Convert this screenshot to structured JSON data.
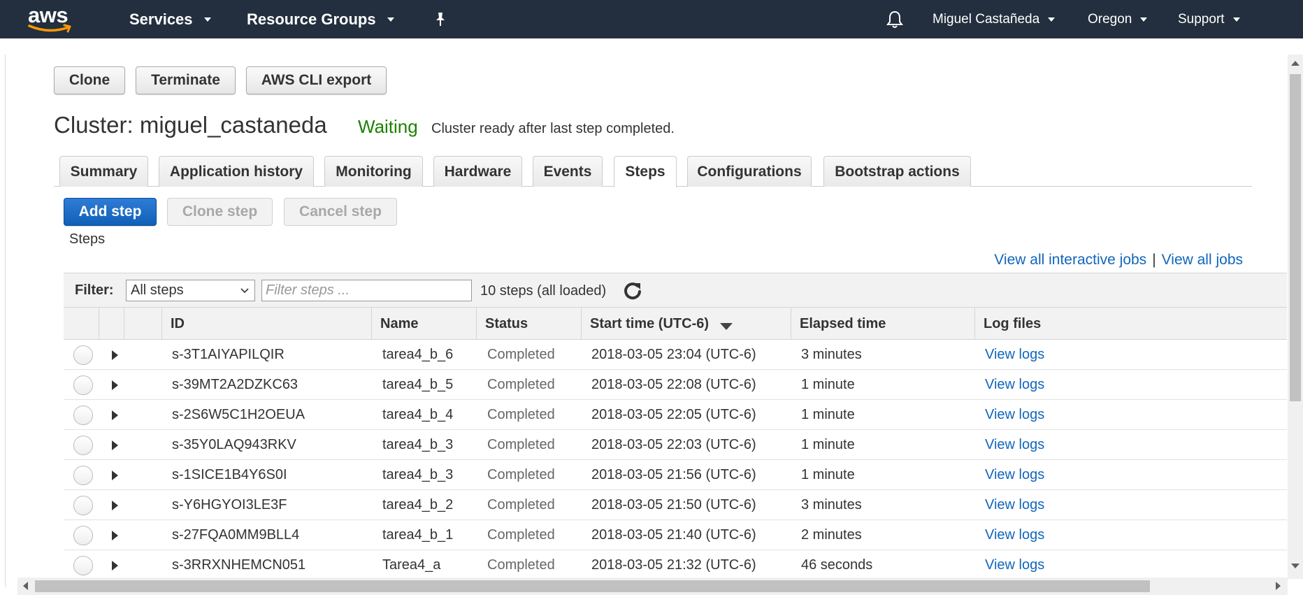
{
  "nav": {
    "logo_text": "aws",
    "services": "Services",
    "resource_groups": "Resource Groups",
    "user": "Miguel Castañeda",
    "region": "Oregon",
    "support": "Support"
  },
  "actions": {
    "clone": "Clone",
    "terminate": "Terminate",
    "cli_export": "AWS CLI export"
  },
  "cluster": {
    "title": "Cluster: miguel_castaneda",
    "state": "Waiting",
    "state_message": "Cluster ready after last step completed."
  },
  "tabs": [
    "Summary",
    "Application history",
    "Monitoring",
    "Hardware",
    "Events",
    "Steps",
    "Configurations",
    "Bootstrap actions"
  ],
  "active_tab": "Steps",
  "step_buttons": {
    "add": "Add step",
    "clone": "Clone step",
    "cancel": "Cancel step"
  },
  "section_label": "Steps",
  "links": {
    "interactive": "View all interactive jobs",
    "separator": "|",
    "all": "View all jobs"
  },
  "filter": {
    "label": "Filter:",
    "select_value": "All steps",
    "placeholder": "Filter steps ...",
    "count": "10 steps (all loaded)"
  },
  "columns": {
    "id": "ID",
    "name": "Name",
    "status": "Status",
    "start": "Start time (UTC-6)",
    "elapsed": "Elapsed time",
    "logs": "Log files"
  },
  "rows": [
    {
      "id": "s-3T1AIYAPILQIR",
      "name": "tarea4_b_6",
      "status": "Completed",
      "start": "2018-03-05 23:04 (UTC-6)",
      "elapsed": "3 minutes",
      "logs": "View logs"
    },
    {
      "id": "s-39MT2A2DZKC63",
      "name": "tarea4_b_5",
      "status": "Completed",
      "start": "2018-03-05 22:08 (UTC-6)",
      "elapsed": "1 minute",
      "logs": "View logs"
    },
    {
      "id": "s-2S6W5C1H2OEUA",
      "name": "tarea4_b_4",
      "status": "Completed",
      "start": "2018-03-05 22:05 (UTC-6)",
      "elapsed": "1 minute",
      "logs": "View logs"
    },
    {
      "id": "s-35Y0LAQ943RKV",
      "name": "tarea4_b_3",
      "status": "Completed",
      "start": "2018-03-05 22:03 (UTC-6)",
      "elapsed": "1 minute",
      "logs": "View logs"
    },
    {
      "id": "s-1SICE1B4Y6S0I",
      "name": "tarea4_b_3",
      "status": "Completed",
      "start": "2018-03-05 21:56 (UTC-6)",
      "elapsed": "1 minute",
      "logs": "View logs"
    },
    {
      "id": "s-Y6HGYOI3LE3F",
      "name": "tarea4_b_2",
      "status": "Completed",
      "start": "2018-03-05 21:50 (UTC-6)",
      "elapsed": "3 minutes",
      "logs": "View logs"
    },
    {
      "id": "s-27FQA0MM9BLL4",
      "name": "tarea4_b_1",
      "status": "Completed",
      "start": "2018-03-05 21:40 (UTC-6)",
      "elapsed": "2 minutes",
      "logs": "View logs"
    },
    {
      "id": "s-3RRXNHEMCN051",
      "name": "Tarea4_a",
      "status": "Completed",
      "start": "2018-03-05 21:32 (UTC-6)",
      "elapsed": "46 seconds",
      "logs": "View logs"
    }
  ],
  "icons": {
    "logo": "aws-smile-logo",
    "pin": "pushpin-icon",
    "notifications": "bell-icon",
    "refresh": "refresh-icon"
  },
  "colors": {
    "nav_bg": "#232f3e",
    "primary_button": "#1a6fc9",
    "waiting_green": "#1d8102",
    "link_blue": "#1166bb"
  }
}
